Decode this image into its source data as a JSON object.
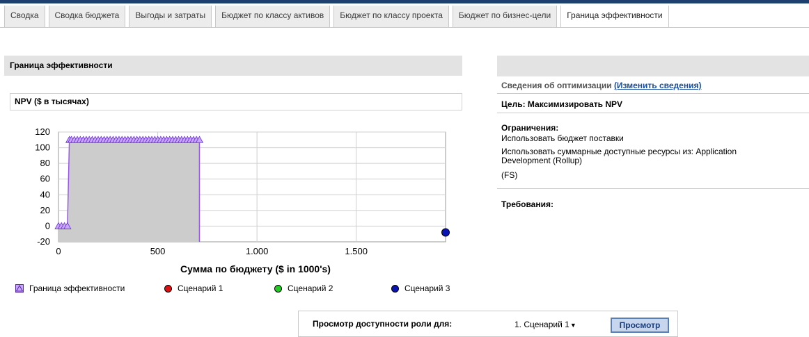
{
  "tabs": [
    {
      "label": "Сводка",
      "active": false
    },
    {
      "label": "Сводка бюджета",
      "active": false
    },
    {
      "label": "Выгоды и затраты",
      "active": false
    },
    {
      "label": "Бюджет по классу активов",
      "active": false
    },
    {
      "label": "Бюджет по классу проекта",
      "active": false
    },
    {
      "label": "Бюджет по бизнес-цели",
      "active": false
    },
    {
      "label": "Граница эффективности",
      "active": true
    }
  ],
  "main": {
    "section_title": "Граница эффективности",
    "npv_label": "NPV ($ в тысячах)"
  },
  "chart_data": {
    "type": "area",
    "xlabel": "Сумма по бюджету ($ in 1000's)",
    "ylabel": "",
    "xlim": [
      0,
      1950
    ],
    "ylim": [
      -20,
      120
    ],
    "x_ticks": [
      "0",
      "500",
      "1.000",
      "1.500"
    ],
    "y_ticks": [
      "120",
      "100",
      "80",
      "60",
      "40",
      "20",
      "0",
      "-20"
    ],
    "grid": true,
    "series": [
      {
        "name": "Граница эффективности",
        "color": "#9b55ef",
        "marker": "triangle",
        "x": [
          0,
          15,
          30,
          45,
          55,
          65,
          80,
          95,
          110,
          125,
          140,
          155,
          170,
          185,
          200,
          215,
          230,
          245,
          260,
          275,
          290,
          305,
          320,
          335,
          350,
          365,
          380,
          395,
          410,
          425,
          440,
          455,
          470,
          485,
          500,
          515,
          530,
          545,
          560,
          575,
          590,
          605,
          620,
          635,
          650,
          665,
          680,
          695,
          710
        ],
        "y": [
          0,
          0,
          0,
          0,
          110,
          110,
          110,
          110,
          110,
          110,
          110,
          110,
          110,
          110,
          110,
          110,
          110,
          110,
          110,
          110,
          110,
          110,
          110,
          110,
          110,
          110,
          110,
          110,
          110,
          110,
          110,
          110,
          110,
          110,
          110,
          110,
          110,
          110,
          110,
          110,
          110,
          110,
          110,
          110,
          110,
          110,
          110,
          110,
          110
        ]
      },
      {
        "name": "Сценарий 1",
        "color": "#e01010",
        "marker": "circle",
        "x": [],
        "y": []
      },
      {
        "name": "Сценарий 2",
        "color": "#22cc22",
        "marker": "circle",
        "x": [],
        "y": []
      },
      {
        "name": "Сценарий 3",
        "color": "#0a14b4",
        "marker": "circle",
        "x": [
          1950
        ],
        "y": [
          -8
        ]
      }
    ],
    "legend": "bottom"
  },
  "bottom": {
    "label": "Просмотр доступности роли для:",
    "select_value": "1. Сценарий 1",
    "view_button": "Просмотр"
  },
  "right_panel": {
    "opt_info_label": "Сведения об оптимизации",
    "change_link": "(Изменить сведения)",
    "goal": "Цель: Максимизировать NPV",
    "constraints_title": "Ограничения:",
    "constraints": [
      "Использовать бюджет поставки",
      "Использовать суммарные доступные ресурсы из: Application",
      "Development (Rollup)",
      "(FS)"
    ],
    "requirements_title": "Требования:"
  },
  "icons": {
    "select_caret": "chevron-down-icon"
  }
}
